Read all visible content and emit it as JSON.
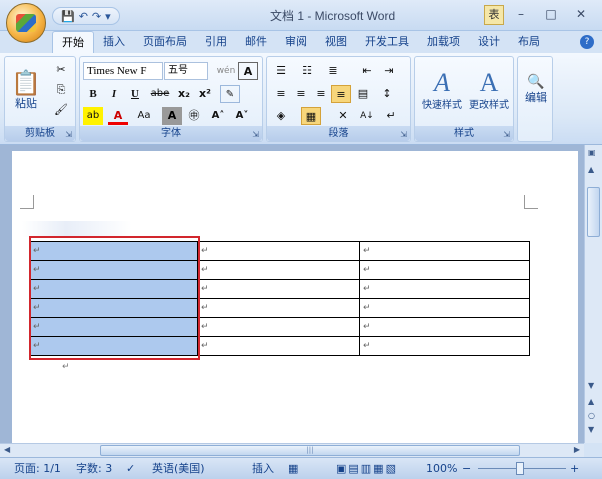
{
  "window": {
    "title": "文档 1 - Microsoft Word",
    "badge": "表",
    "min_glyph": "–",
    "max_glyph": "□",
    "close_glyph": "✕"
  },
  "qat": {
    "save": "💾",
    "undo": "↶",
    "redo": "↷",
    "more": "▾"
  },
  "tabs": [
    "开始",
    "插入",
    "页面布局",
    "引用",
    "邮件",
    "审阅",
    "视图",
    "开发工具",
    "加载项",
    "设计",
    "布局"
  ],
  "active_tab": 0,
  "help": "?",
  "ribbon": {
    "clipboard": {
      "label": "剪贴板",
      "paste": "粘贴",
      "cut": "✂",
      "copy": "⎘",
      "format_painter": "🖌"
    },
    "font": {
      "label": "字体",
      "name": "Times New F",
      "size": "五号",
      "bold": "B",
      "italic": "I",
      "underline": "U",
      "strike": "abe",
      "subscript": "x₂",
      "superscript": "x²",
      "highlight": "ab",
      "color_a": "A",
      "case": "Aa",
      "shade_a": "A",
      "enclose": "㊥",
      "grow": "A˄",
      "shrink": "A˅",
      "phonetic": "wén",
      "border_a": "A"
    },
    "paragraph": {
      "label": "段落",
      "sort": "A↓",
      "marks": "↵"
    },
    "styles": {
      "label": "样式",
      "quick": "快速样式",
      "change": "更改样式"
    },
    "editing": {
      "label": "编辑",
      "icon": "🔍"
    }
  },
  "table": {
    "rows": 6,
    "cols": 3,
    "selected_col": 0,
    "cell_mark": "↵",
    "selected_rows_start": 1
  },
  "status": {
    "page": "页面: 1/1",
    "words": "字数: 3",
    "lang": "英语(美国)",
    "mode": "插入",
    "zoom": "100%",
    "zoom_minus": "−",
    "zoom_plus": "+"
  }
}
